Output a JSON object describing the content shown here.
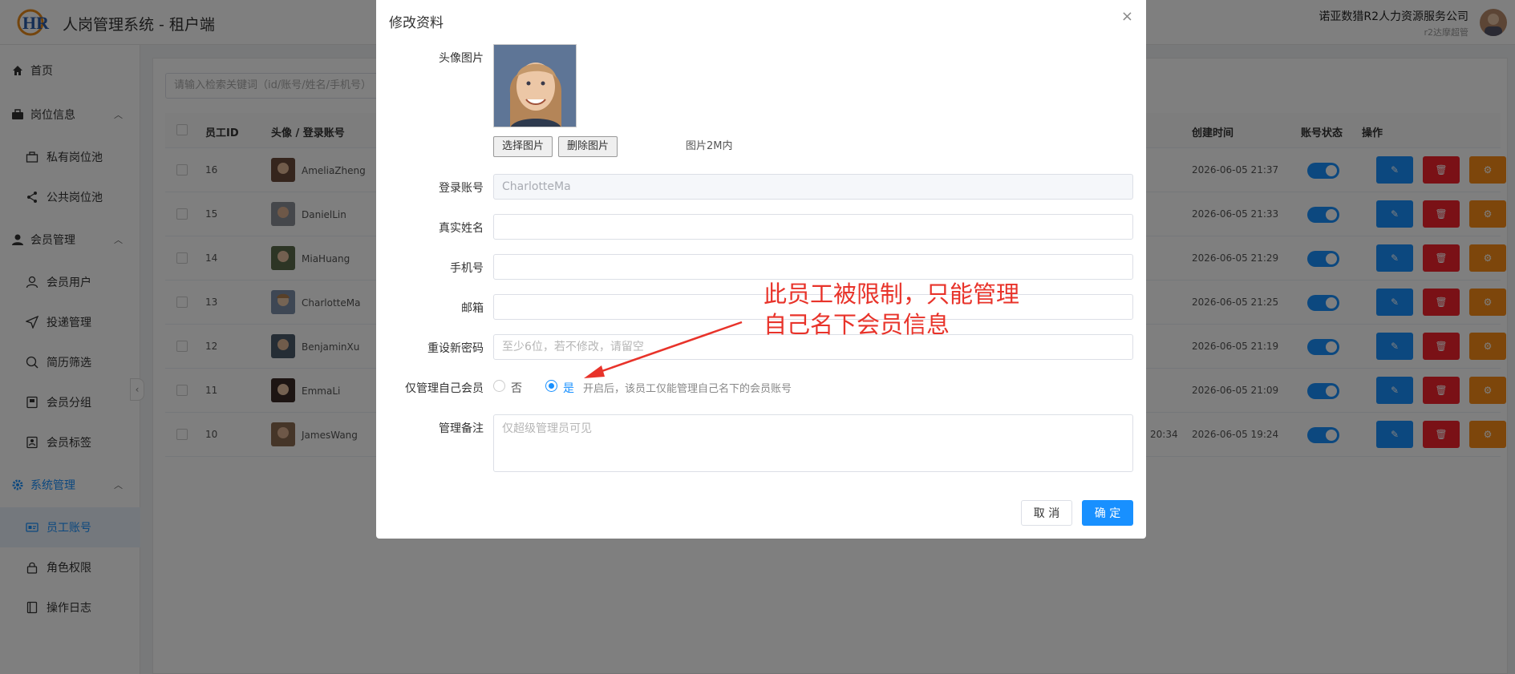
{
  "header": {
    "app_title": "人岗管理系统 - 租户端",
    "logo_text": "HR",
    "company_name": "诺亚数猎R2人力资源服务公司",
    "user_role": "r2达摩超管"
  },
  "search": {
    "placeholder": "请输入检索关键词（id/账号/姓名/手机号）"
  },
  "sidebar": {
    "items": [
      {
        "label": "首页",
        "icon": "home-icon"
      },
      {
        "label": "岗位信息",
        "icon": "briefcase-icon"
      },
      {
        "label": "私有岗位池",
        "icon": "box-icon"
      },
      {
        "label": "公共岗位池",
        "icon": "share-icon"
      },
      {
        "label": "会员管理",
        "icon": "user-icon"
      },
      {
        "label": "会员用户",
        "icon": "user-outline-icon"
      },
      {
        "label": "投递管理",
        "icon": "send-icon"
      },
      {
        "label": "简历筛选",
        "icon": "search-icon"
      },
      {
        "label": "会员分组",
        "icon": "group-icon"
      },
      {
        "label": "会员标签",
        "icon": "tag-icon"
      },
      {
        "label": "系统管理",
        "icon": "gear-icon"
      },
      {
        "label": "员工账号",
        "icon": "id-card-icon"
      },
      {
        "label": "角色权限",
        "icon": "lock-icon"
      },
      {
        "label": "操作日志",
        "icon": "book-icon"
      }
    ]
  },
  "table": {
    "headers": {
      "id": "员工ID",
      "account": "头像 / 登录账号",
      "created": "创建时间",
      "status": "账号状态",
      "ops": "操作"
    },
    "rows": [
      {
        "id": "16",
        "account": "AmeliaZheng",
        "created": "2026-06-05 21:37",
        "extra": ""
      },
      {
        "id": "15",
        "account": "DanielLin",
        "created": "2026-06-05 21:33",
        "extra": ""
      },
      {
        "id": "14",
        "account": "MiaHuang",
        "created": "2026-06-05 21:29",
        "extra": ""
      },
      {
        "id": "13",
        "account": "CharlotteMa",
        "created": "2026-06-05 21:25",
        "extra": ""
      },
      {
        "id": "12",
        "account": "BenjaminXu",
        "created": "2026-06-05 21:19",
        "extra": ""
      },
      {
        "id": "11",
        "account": "EmmaLi",
        "created": "2026-06-05 21:09",
        "extra": ""
      },
      {
        "id": "10",
        "account": "JamesWang",
        "created": "2026-06-05 19:24",
        "extra": "20:34"
      }
    ]
  },
  "modal": {
    "title": "修改资料",
    "close": "×",
    "avatar_label": "头像图片",
    "choose_image": "选择图片",
    "delete_image": "删除图片",
    "image_hint": "图片2M内",
    "login_label": "登录账号",
    "login_value": "CharlotteMa",
    "name_label": "真实姓名",
    "name_value": "",
    "phone_label": "手机号",
    "phone_value": "",
    "email_label": "邮箱",
    "email_value": "",
    "password_label": "重设新密码",
    "password_placeholder": "至少6位，若不修改，请留空",
    "restrict_label": "仅管理自己会员",
    "restrict_no": "否",
    "restrict_yes": "是",
    "restrict_selected": "是",
    "restrict_hint": "开启后，该员工仅能管理自己名下的会员账号",
    "remark_label": "管理备注",
    "remark_placeholder": "仅超级管理员可见",
    "cancel": "取 消",
    "confirm": "确 定"
  },
  "annotation": {
    "line1": "此员工被限制，只能管理",
    "line2": "自己名下会员信息"
  },
  "colors": {
    "primary": "#1890ff",
    "danger": "#f5222d",
    "warning": "#fa8c16",
    "annotation": "#e8332a"
  }
}
